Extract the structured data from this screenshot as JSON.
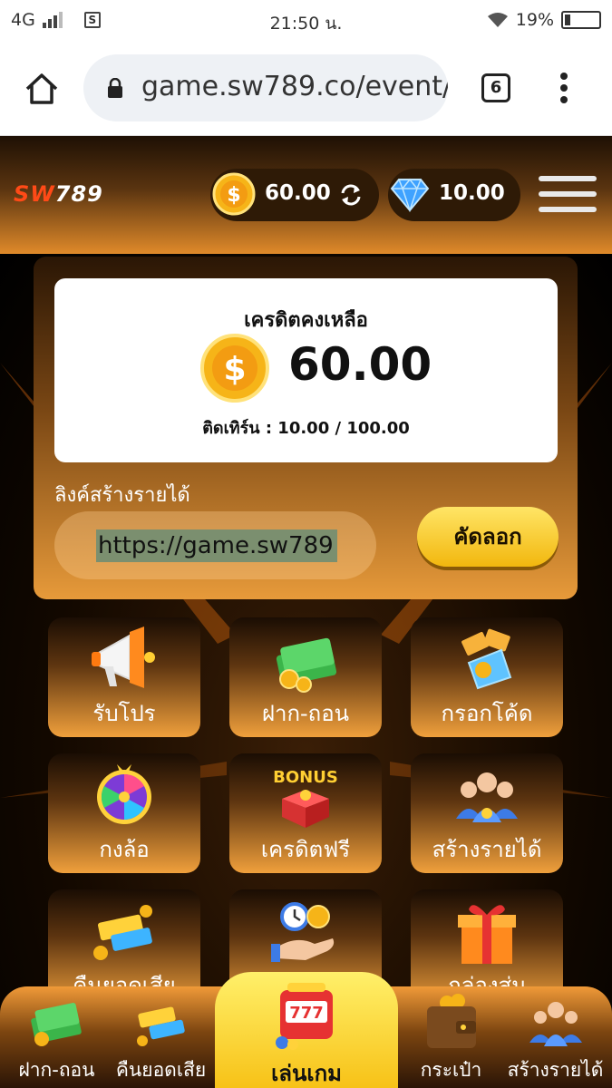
{
  "status_bar": {
    "network": "4G",
    "time": "21:50 น.",
    "battery": "19%"
  },
  "browser": {
    "url": "game.sw789.co/event/",
    "tab_count": "6"
  },
  "header": {
    "logo_prefix": "SW",
    "logo_suffix": "789",
    "coin_balance": "60.00",
    "gem_balance": "10.00"
  },
  "credit": {
    "title": "เครดิตคงเหลือ",
    "amount": "60.00",
    "turnover_label": "ติดเทิร์น : 10.00 / 100.00"
  },
  "referral": {
    "label": "ลิงค์สร้างรายได้",
    "link": "https://game.sw789",
    "copy_label": "คัดลอก"
  },
  "menu": {
    "tiles": [
      {
        "label": "รับโปร",
        "icon": "megaphone-icon"
      },
      {
        "label": "ฝาก-ถอน",
        "icon": "money-stack-icon"
      },
      {
        "label": "กรอกโค้ด",
        "icon": "tickets-icon"
      },
      {
        "label": "กงล้อ",
        "icon": "wheel-icon"
      },
      {
        "label": "เครดิตฟรี",
        "icon": "bonus-box-icon"
      },
      {
        "label": "สร้างรายได้",
        "icon": "people-icon"
      },
      {
        "label": "คืนยอดเสีย",
        "icon": "cashback-icon"
      },
      {
        "label": "",
        "icon": "time-money-icon"
      },
      {
        "label": "กล่องสุ่ม",
        "icon": "gift-box-icon"
      }
    ]
  },
  "bottom_nav": {
    "deposit": "ฝาก-ถอน",
    "cashback": "คืนยอดเสีย",
    "play": "เล่นเกม",
    "wallet": "กระเป๋า",
    "earn": "สร้างรายได้"
  },
  "colors": {
    "accent_orange": "#f09a38",
    "gold": "#f7c217",
    "brand_red": "#ff4a17"
  }
}
